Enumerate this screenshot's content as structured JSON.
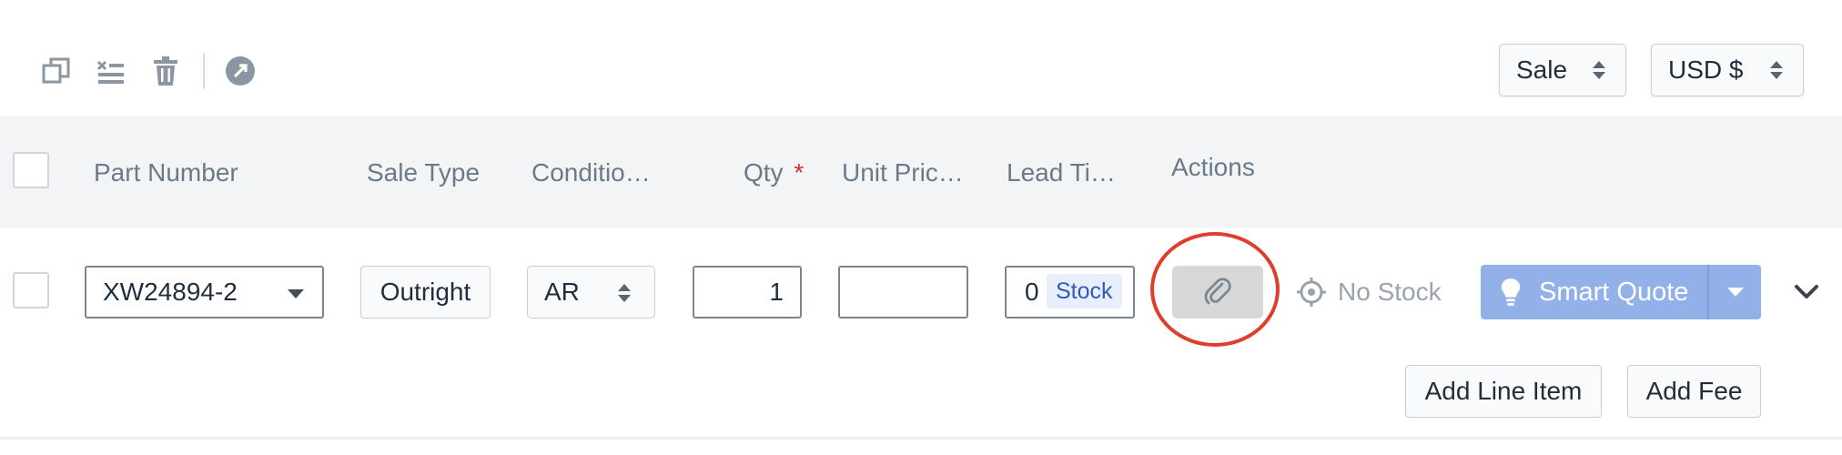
{
  "toolbar": {
    "icons": [
      "copy-icon",
      "clear-lines-icon",
      "trash-icon",
      "share-icon"
    ],
    "sale_select": "Sale",
    "currency_select": "USD $"
  },
  "table": {
    "columns": {
      "part_number": "Part Number",
      "sale_type": "Sale Type",
      "condition": "Conditio…",
      "qty": "Qty",
      "qty_required_mark": "*",
      "unit_price": "Unit Pric…",
      "lead_time": "Lead Ti…",
      "actions": "Actions"
    },
    "row": {
      "part_number": "XW24894-2",
      "sale_type": "Outright",
      "condition": "AR",
      "qty": "1",
      "unit_price": "",
      "lead_time": "0",
      "lead_time_badge": "Stock",
      "stock_status": "No Stock",
      "smart_quote": "Smart Quote"
    }
  },
  "footer": {
    "add_line_item": "Add Line Item",
    "add_fee": "Add Fee"
  },
  "colors": {
    "accent": "#93b1e9",
    "highlight": "#e03e2d",
    "header_bg": "#f3f4f6"
  }
}
